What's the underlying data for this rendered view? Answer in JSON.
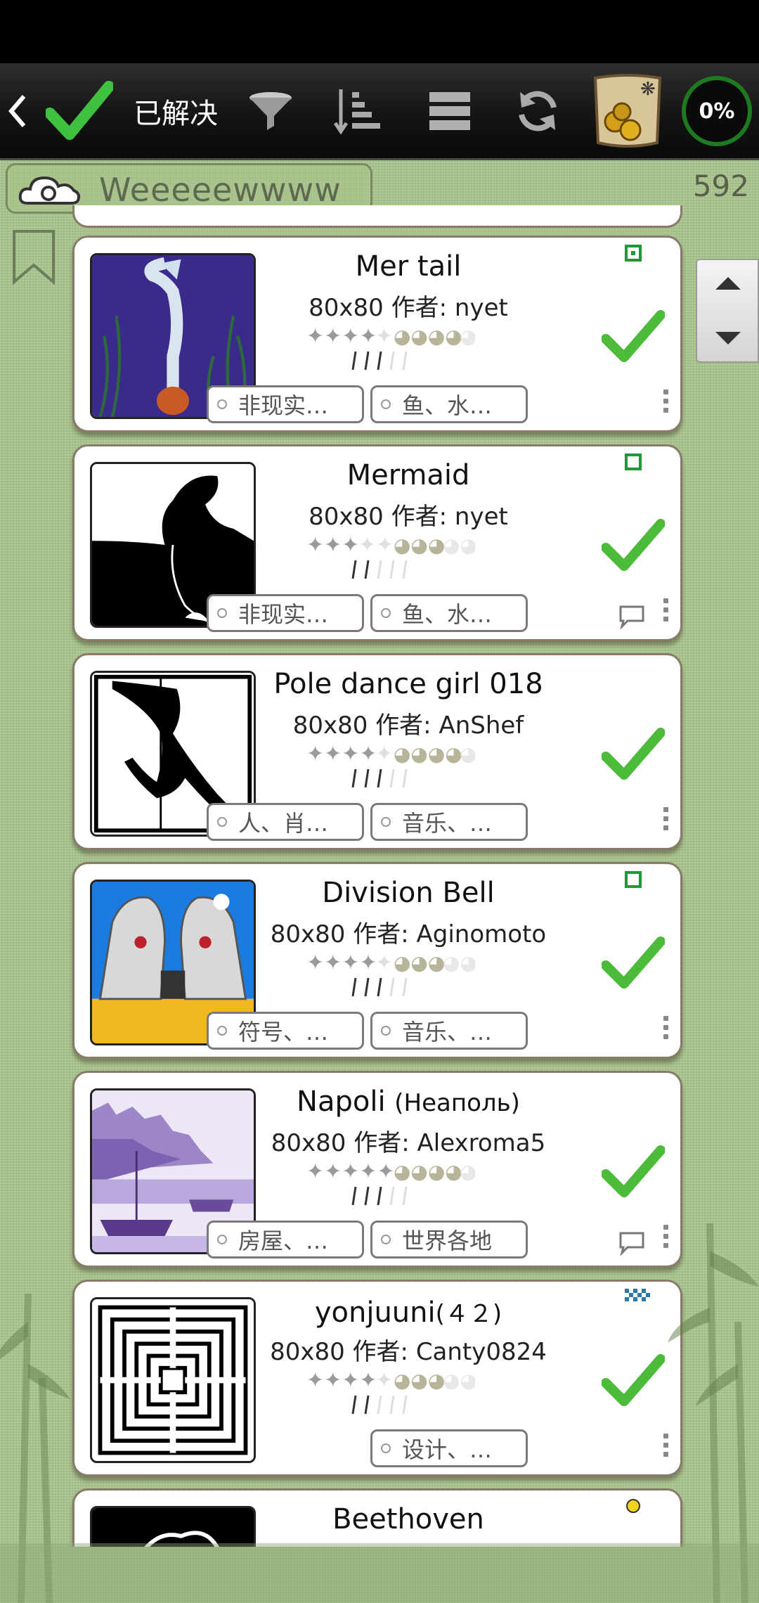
{
  "toolbar": {
    "solved_label": "已解决",
    "progress_percent": "0%"
  },
  "search": {
    "value": "Weeeeewwww"
  },
  "result_count": "592",
  "puzzles": [
    {
      "title": "Mer tail",
      "title_extra": "",
      "size": "80x80",
      "author_prefix": "作者:",
      "author": "nyet",
      "tags": [
        "非现实…",
        "鱼、水…"
      ],
      "difficulty_stars": 3.5,
      "rating_fans": 3.5,
      "knives": 3,
      "marker": "green-square-filled",
      "has_comment": false
    },
    {
      "title": "Mermaid",
      "title_extra": "",
      "size": "80x80",
      "author_prefix": "作者:",
      "author": "nyet",
      "tags": [
        "非现实…",
        "鱼、水…"
      ],
      "difficulty_stars": 3,
      "rating_fans": 3,
      "knives": 2,
      "marker": "green-square-outline",
      "has_comment": true
    },
    {
      "title": "Pole dance girl 018",
      "title_extra": "",
      "size": "80x80",
      "author_prefix": "作者:",
      "author": "AnShef",
      "tags": [
        "人、肖…",
        "音乐、…"
      ],
      "difficulty_stars": 3.5,
      "rating_fans": 3.5,
      "knives": 3,
      "marker": "",
      "has_comment": false
    },
    {
      "title": "Division Bell",
      "title_extra": "",
      "size": "80x80",
      "author_prefix": "作者:",
      "author": "Aginomoto",
      "tags": [
        "符号、…",
        "音乐、…"
      ],
      "difficulty_stars": 3.5,
      "rating_fans": 3,
      "knives": 3,
      "marker": "green-square-outline",
      "has_comment": false
    },
    {
      "title": "Napoli",
      "title_extra": "(Неаполь)",
      "size": "80x80",
      "author_prefix": "作者:",
      "author": "Alexroma5",
      "tags": [
        "房屋、…",
        "世界各地"
      ],
      "difficulty_stars": 4,
      "rating_fans": 4,
      "knives": 3,
      "marker": "",
      "has_comment": true
    },
    {
      "title": "yonjuuni",
      "title_extra": "(４２)",
      "size": "80x80",
      "author_prefix": "作者:",
      "author": "Canty0824",
      "tags": [
        "",
        "设计、…"
      ],
      "difficulty_stars": 3.5,
      "rating_fans": 3.5,
      "knives": 2,
      "marker": "blue-checker",
      "has_comment": false
    },
    {
      "title": "Beethoven",
      "title_extra": "",
      "size": "",
      "author_prefix": "",
      "author": "",
      "tags": [],
      "difficulty_stars": 0,
      "rating_fans": 0,
      "knives": 0,
      "marker": "yellow-dot",
      "has_comment": false
    }
  ],
  "colors": {
    "accent_green": "#3aa13a",
    "check_green": "#4cbb3a",
    "card_border": "#8a7a6a"
  }
}
